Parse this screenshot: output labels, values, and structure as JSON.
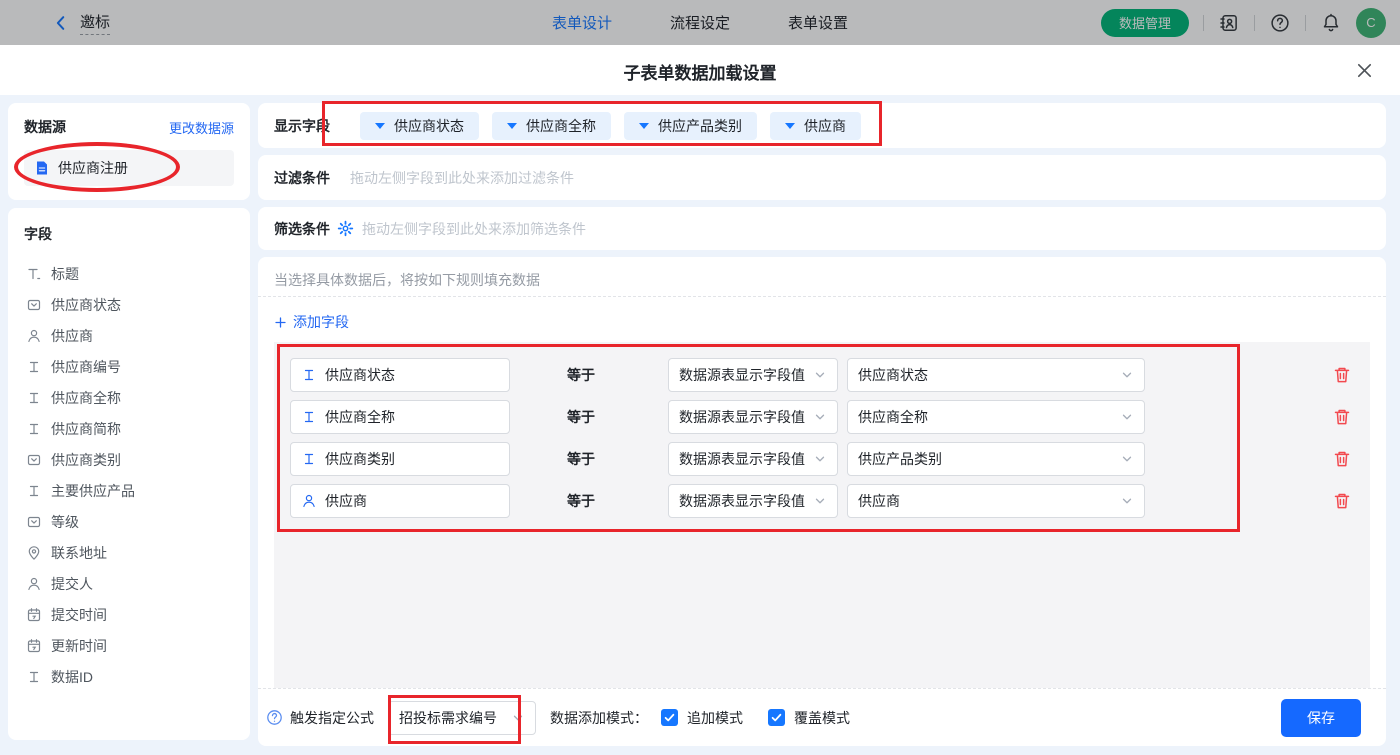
{
  "topbar": {
    "back_label": "邀标",
    "tabs": [
      {
        "label": "表单设计",
        "active": true
      },
      {
        "label": "流程设定",
        "active": false
      },
      {
        "label": "表单设置",
        "active": false
      }
    ],
    "data_manage_label": "数据管理",
    "avatar_letter": "C"
  },
  "modal": {
    "title": "子表单数据加载设置"
  },
  "sidebar": {
    "datasource_title": "数据源",
    "change_link": "更改数据源",
    "datasource_item": "供应商注册",
    "fields_title": "字段",
    "fields": [
      {
        "icon": "title-icon",
        "label": "标题"
      },
      {
        "icon": "select-icon",
        "label": "供应商状态"
      },
      {
        "icon": "person-icon",
        "label": "供应商"
      },
      {
        "icon": "text-icon",
        "label": "供应商编号"
      },
      {
        "icon": "text-icon",
        "label": "供应商全称"
      },
      {
        "icon": "text-icon",
        "label": "供应商简称"
      },
      {
        "icon": "select-icon",
        "label": "供应商类别"
      },
      {
        "icon": "text-icon",
        "label": "主要供应产品"
      },
      {
        "icon": "select-icon",
        "label": "等级"
      },
      {
        "icon": "location-icon",
        "label": "联系地址"
      },
      {
        "icon": "person-icon",
        "label": "提交人"
      },
      {
        "icon": "calendar-icon",
        "label": "提交时间"
      },
      {
        "icon": "calendar-icon",
        "label": "更新时间"
      },
      {
        "icon": "text-icon",
        "label": "数据ID"
      }
    ]
  },
  "display_fields": {
    "label": "显示字段",
    "tags": [
      "供应商状态",
      "供应商全称",
      "供应产品类别",
      "供应商"
    ]
  },
  "filter_row": {
    "label": "过滤条件",
    "placeholder": "拖动左侧字段到此处来添加过滤条件"
  },
  "screen_row": {
    "label": "筛选条件",
    "placeholder": "拖动左侧字段到此处来添加筛选条件"
  },
  "fill_rules": {
    "hint": "当选择具体数据后，将按如下规则填充数据",
    "add_field_label": "添加字段",
    "rows": [
      {
        "icon": "text-icon",
        "field": "供应商状态",
        "operator": "等于",
        "source": "数据源表显示字段值",
        "value": "供应商状态"
      },
      {
        "icon": "text-icon",
        "field": "供应商全称",
        "operator": "等于",
        "source": "数据源表显示字段值",
        "value": "供应商全称"
      },
      {
        "icon": "text-icon",
        "field": "供应商类别",
        "operator": "等于",
        "source": "数据源表显示字段值",
        "value": "供应产品类别"
      },
      {
        "icon": "person-icon",
        "field": "供应商",
        "operator": "等于",
        "source": "数据源表显示字段值",
        "value": "供应商"
      }
    ]
  },
  "footer": {
    "trigger_label": "触发指定公式",
    "formula_value": "招投标需求编号",
    "mode_label": "数据添加模式：",
    "modes": [
      {
        "label": "追加模式",
        "checked": true
      },
      {
        "label": "覆盖模式",
        "checked": true
      }
    ],
    "save_label": "保存"
  },
  "colors": {
    "accent": "#1677ff",
    "annotation_red": "#e8252b",
    "topbar_green": "#00b578",
    "save_blue": "#1569ff"
  }
}
